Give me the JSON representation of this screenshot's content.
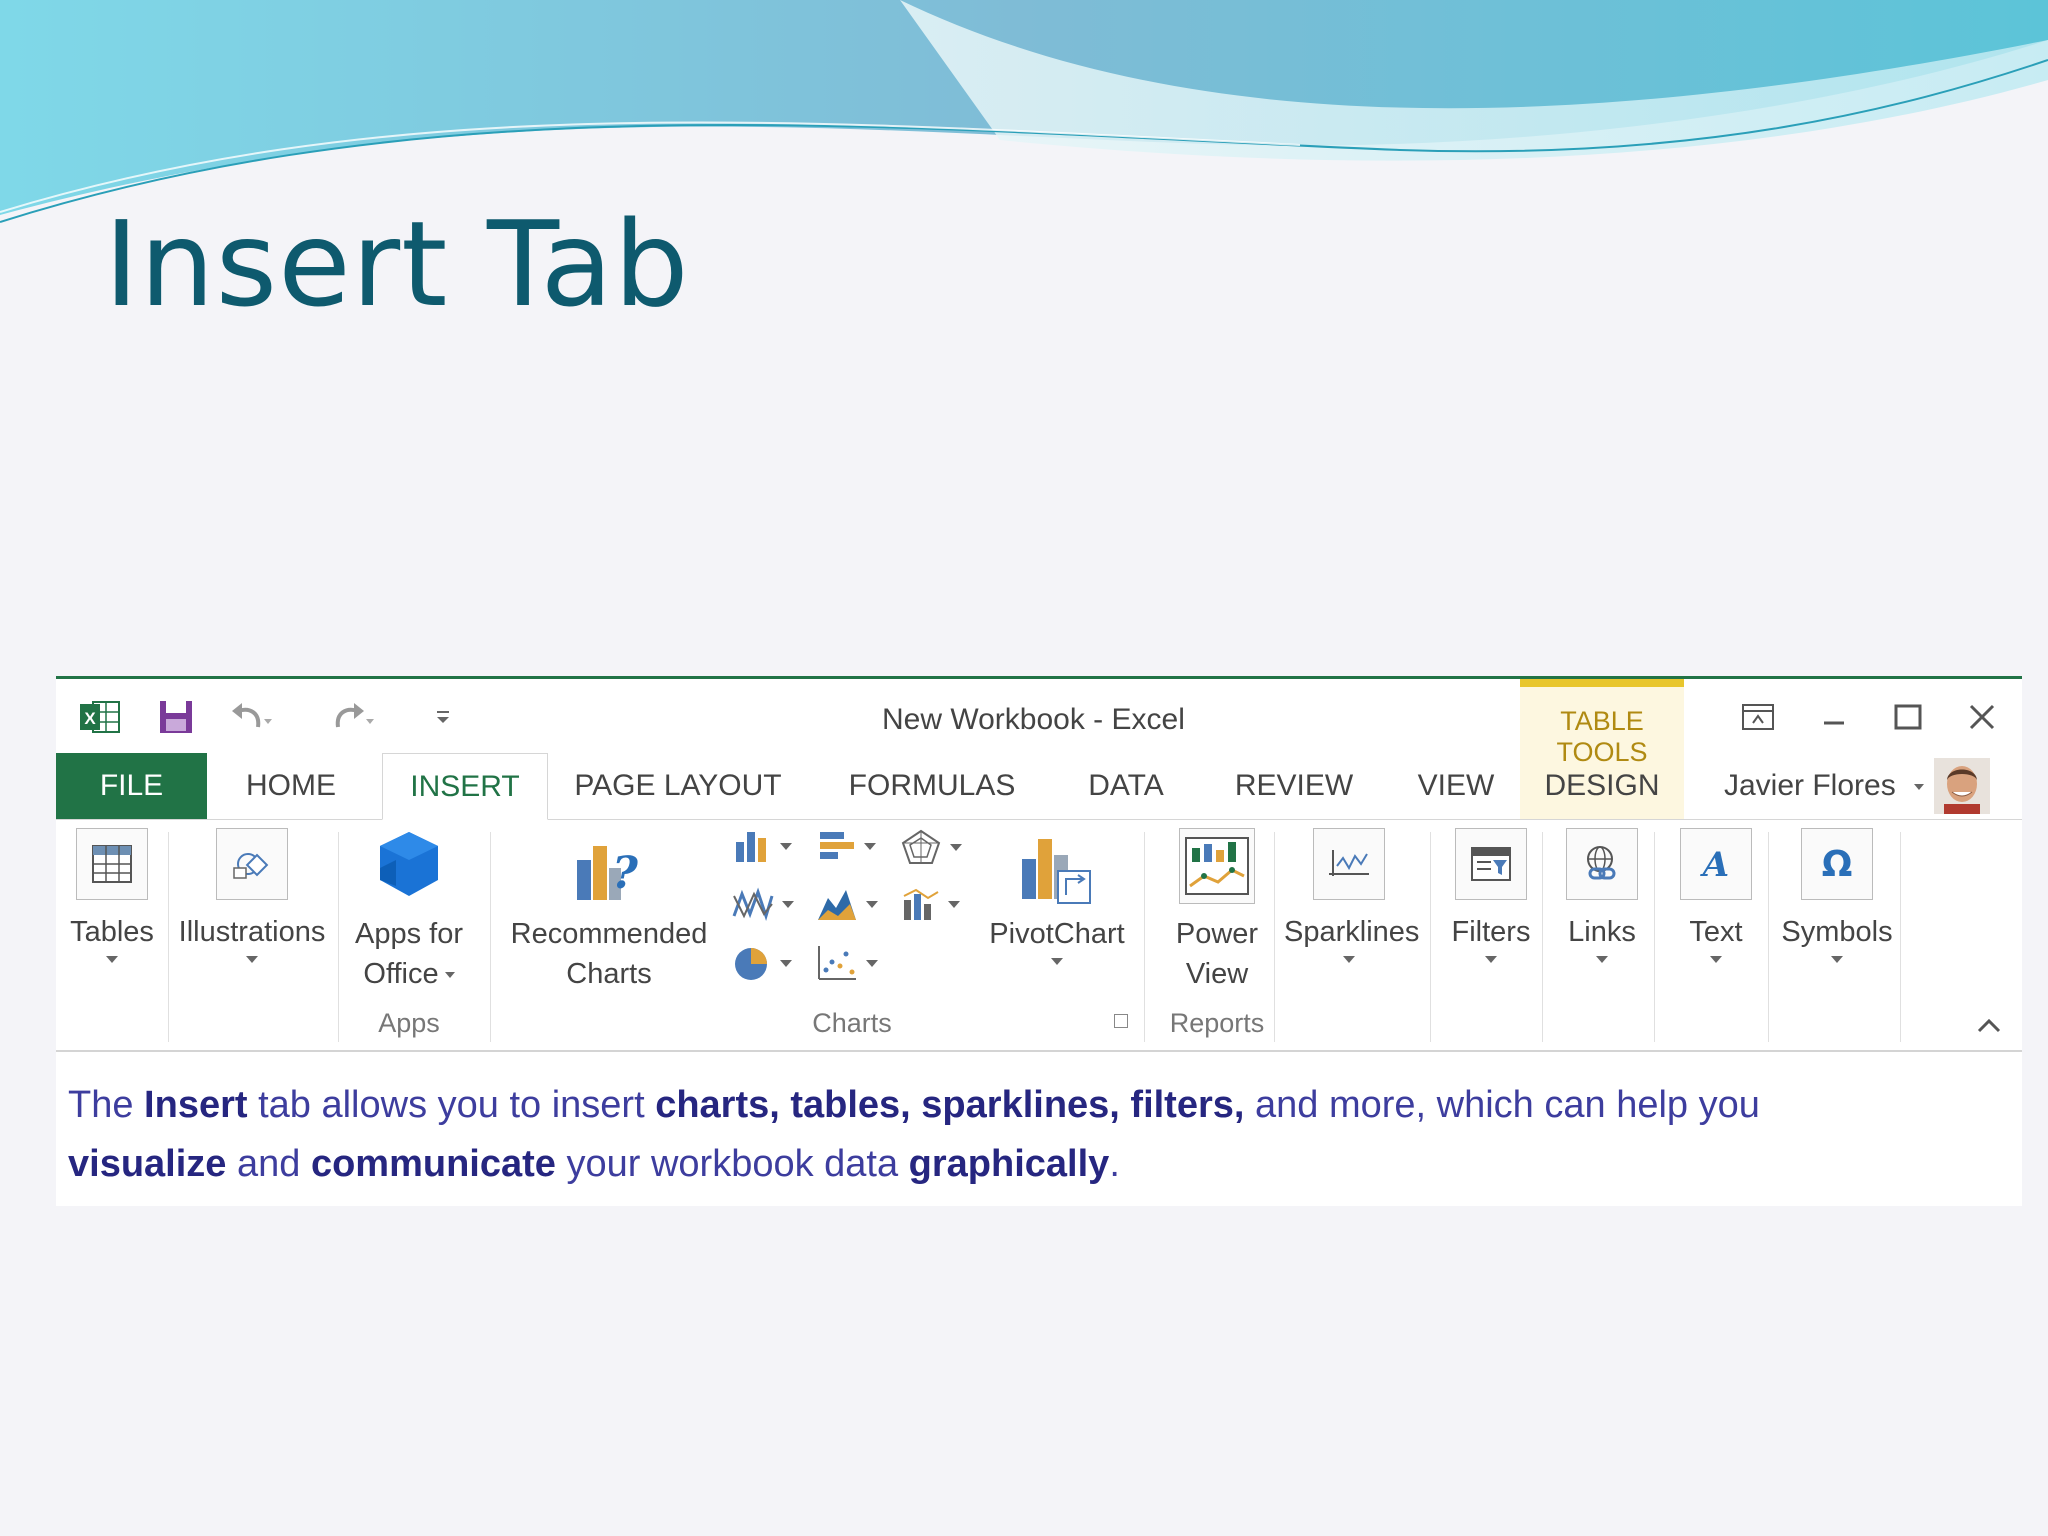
{
  "slide": {
    "title": "Insert Tab"
  },
  "window": {
    "title": "New Workbook - Excel",
    "contextual_label": "TABLE TOOLS",
    "user_name": "Javier Flores"
  },
  "tabs": [
    {
      "label": "FILE"
    },
    {
      "label": "HOME"
    },
    {
      "label": "INSERT"
    },
    {
      "label": "PAGE LAYOUT"
    },
    {
      "label": "FORMULAS"
    },
    {
      "label": "DATA"
    },
    {
      "label": "REVIEW"
    },
    {
      "label": "VIEW"
    },
    {
      "label": "DESIGN"
    }
  ],
  "ribbon": {
    "tables": "Tables",
    "illustrations": "Illustrations",
    "apps_line1": "Apps for",
    "apps_line2": "Office",
    "recommended_line1": "Recommended",
    "recommended_line2": "Charts",
    "pivotchart": "PivotChart",
    "power_line1": "Power",
    "power_line2": "View",
    "sparklines": "Sparklines",
    "filters": "Filters",
    "links": "Links",
    "text": "Text",
    "symbols": "Symbols",
    "groups": {
      "apps": "Apps",
      "charts": "Charts",
      "reports": "Reports"
    }
  },
  "description": {
    "p1": "The ",
    "p2": "Insert",
    "p3": " tab allows you to insert ",
    "p4": "charts, tables, sparklines, filters,",
    "p5": " and more, which can help you",
    "p6": "visualize",
    "p7": " and ",
    "p8": "communicate",
    "p9": " your workbook data ",
    "p10": "graphically",
    "p11": "."
  },
  "colors": {
    "excel_green": "#217346",
    "title_teal": "#0e5a6e",
    "contextual_gold": "#e8c62c",
    "text_navy": "#3d3d9e"
  }
}
